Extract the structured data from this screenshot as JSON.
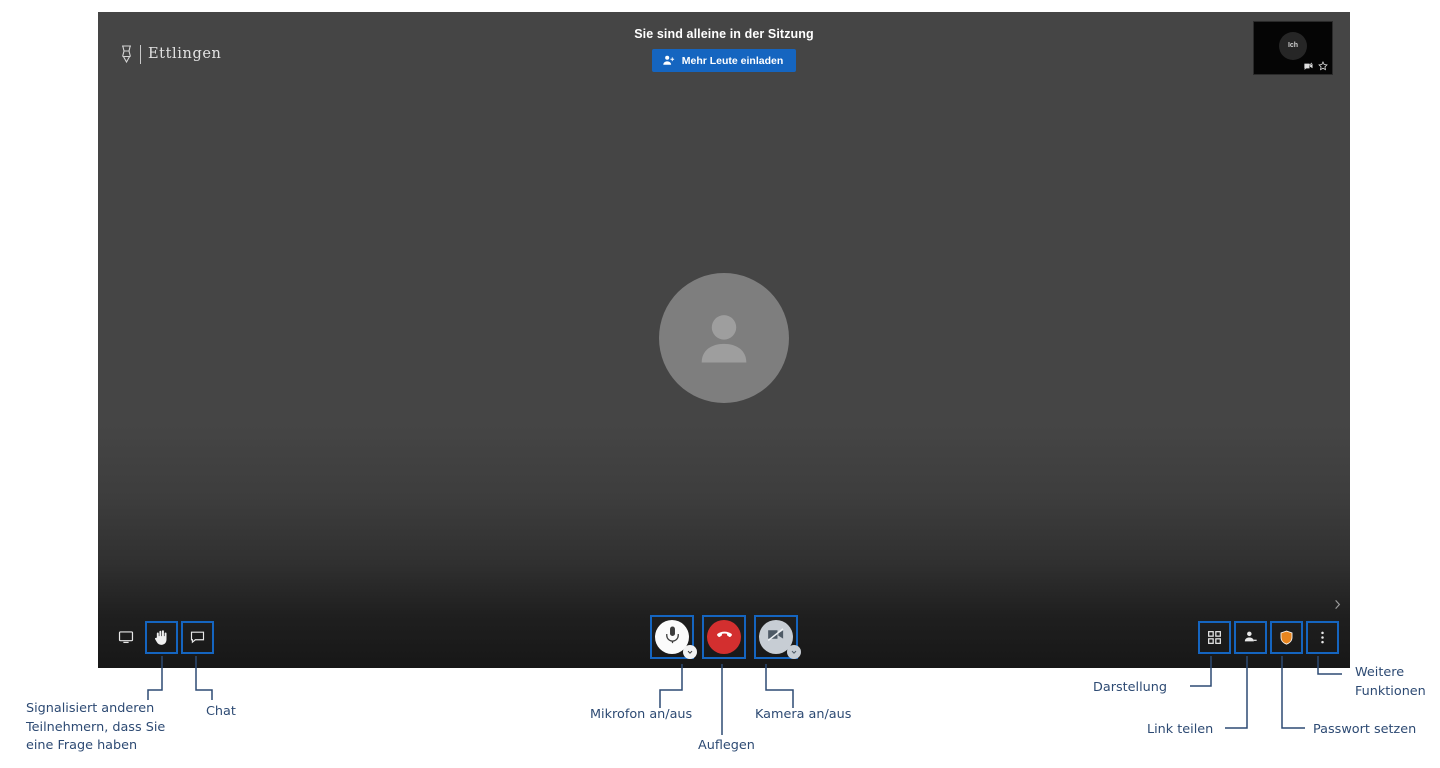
{
  "app": {
    "brand_name": "Ettlingen",
    "brand_icon": "ettlingen-crest-icon"
  },
  "header": {
    "status_text": "Sie sind alleine in der Sitzung",
    "invite_button_label": "Mehr Leute einladen",
    "invite_button_icon": "person-add-icon",
    "invite_button_color": "#1565c0"
  },
  "selfview": {
    "label": "Ich",
    "camera_off_icon": "camera-off-icon",
    "pin_icon": "star-icon"
  },
  "stage": {
    "participant_avatar_icon": "person-avatar-icon",
    "avatar_bg_color": "#7e7e7e",
    "background_color": "#454545",
    "edge_expand_icon": "chevron-right-icon"
  },
  "toolbar": {
    "left": [
      {
        "name": "screen-share-button",
        "icon": "monitor-screen-share-icon",
        "label": "Bildschirm teilen",
        "highlighted": false
      },
      {
        "name": "raise-hand-button",
        "icon": "raised-hand-icon",
        "label": "Hand heben",
        "highlighted": true
      },
      {
        "name": "chat-button",
        "icon": "chat-bubble-icon",
        "label": "Chat",
        "highlighted": true
      }
    ],
    "center": [
      {
        "name": "microphone-toggle-button",
        "icon": "microphone-icon",
        "label": "Mikrofon an/aus",
        "style": "mic",
        "badge_icon": "chevron-down-icon",
        "highlighted": true
      },
      {
        "name": "hangup-button",
        "icon": "phone-hangup-icon",
        "label": "Auflegen",
        "style": "hangup",
        "badge_icon": "",
        "highlighted": true
      },
      {
        "name": "camera-toggle-button",
        "icon": "camera-off-icon",
        "label": "Kamera an/aus",
        "style": "cam",
        "badge_icon": "chevron-down-icon",
        "highlighted": true
      }
    ],
    "right": [
      {
        "name": "layout-view-button",
        "icon": "grid-tiles-icon",
        "label": "Darstellung",
        "highlighted": true
      },
      {
        "name": "share-link-button",
        "icon": "person-share-icon",
        "label": "Link teilen",
        "highlighted": true
      },
      {
        "name": "set-password-button",
        "icon": "shield-icon",
        "label": "Passwort setzen",
        "highlighted": true,
        "color": "#e8851f"
      },
      {
        "name": "more-functions-button",
        "icon": "more-vertical-icon",
        "label": "Weitere Funktionen",
        "highlighted": true
      }
    ]
  },
  "annotations": [
    {
      "id": "ann-raise-hand",
      "text": "Signalisiert anderen\nTeilnehmern, dass Sie\neine Frage haben"
    },
    {
      "id": "ann-chat",
      "text": "Chat"
    },
    {
      "id": "ann-microphone",
      "text": "Mikrofon an/aus"
    },
    {
      "id": "ann-hangup",
      "text": "Auflegen"
    },
    {
      "id": "ann-camera",
      "text": "Kamera an/aus"
    },
    {
      "id": "ann-layout",
      "text": "Darstellung"
    },
    {
      "id": "ann-share-link",
      "text": "Link teilen"
    },
    {
      "id": "ann-password",
      "text": "Passwort setzen"
    },
    {
      "id": "ann-more",
      "text": "Weitere\nFunktionen"
    }
  ],
  "annotation_color": "#2d4a73"
}
